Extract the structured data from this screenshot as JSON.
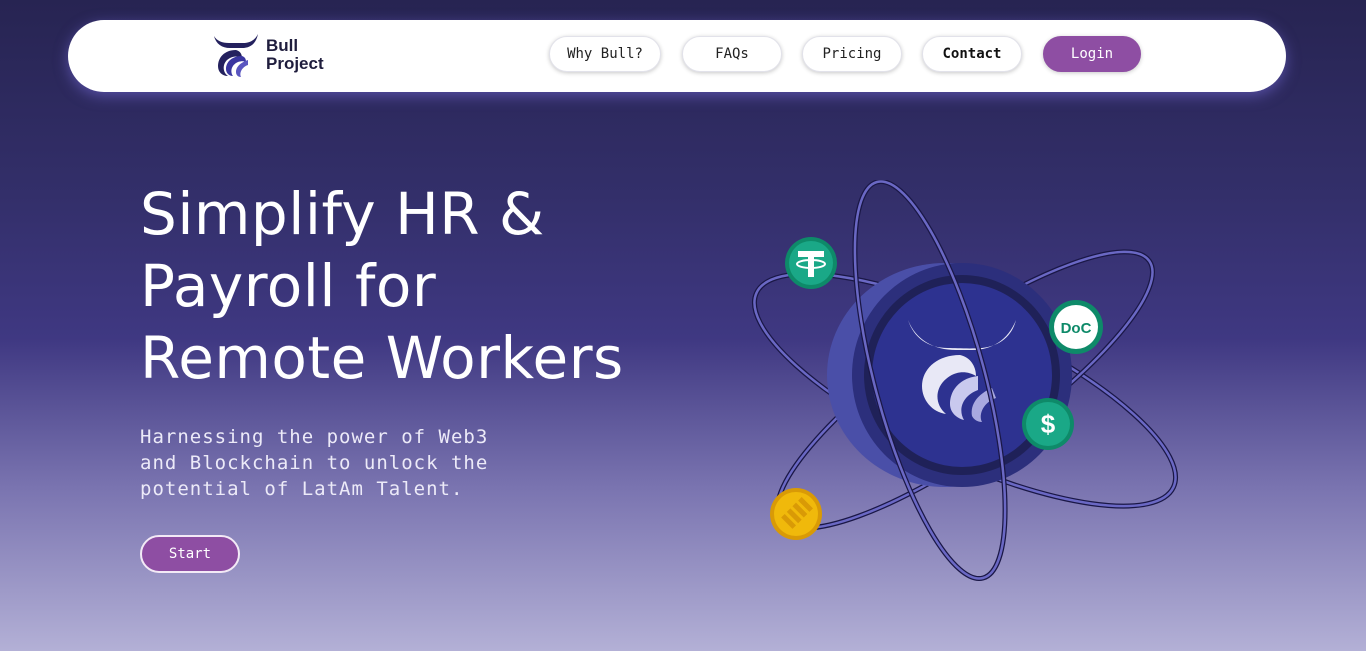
{
  "brand": {
    "line1": "Bull",
    "line2": "Project",
    "logo_icon": "bull-horns-logo"
  },
  "nav": {
    "items": [
      {
        "label": "Why Bull?"
      },
      {
        "label": "FAQs"
      },
      {
        "label": "Pricing"
      },
      {
        "label": "Contact"
      }
    ],
    "login_label": "Login"
  },
  "hero": {
    "title_lines": [
      "Simplify HR &",
      "Payroll for",
      "Remote Workers"
    ],
    "subtitle_lines": [
      "Harnessing the power of Web3",
      "and Blockchain to unlock the",
      "potential of LatAm Talent."
    ],
    "start_label": "Start"
  },
  "illustration": {
    "coins": [
      {
        "name": "tether-coin",
        "symbol": "T"
      },
      {
        "name": "doc-coin",
        "symbol": "DoC"
      },
      {
        "name": "dollar-coin",
        "symbol": "$"
      },
      {
        "name": "binance-coin",
        "symbol": ""
      }
    ]
  },
  "colors": {
    "accent": "#8e4ea3",
    "background_top": "#272452",
    "background_bottom": "#b3b0d6",
    "brand_dark": "#1f1d3d",
    "coin_green": "#14a37f",
    "coin_gold": "#f0b90b"
  }
}
